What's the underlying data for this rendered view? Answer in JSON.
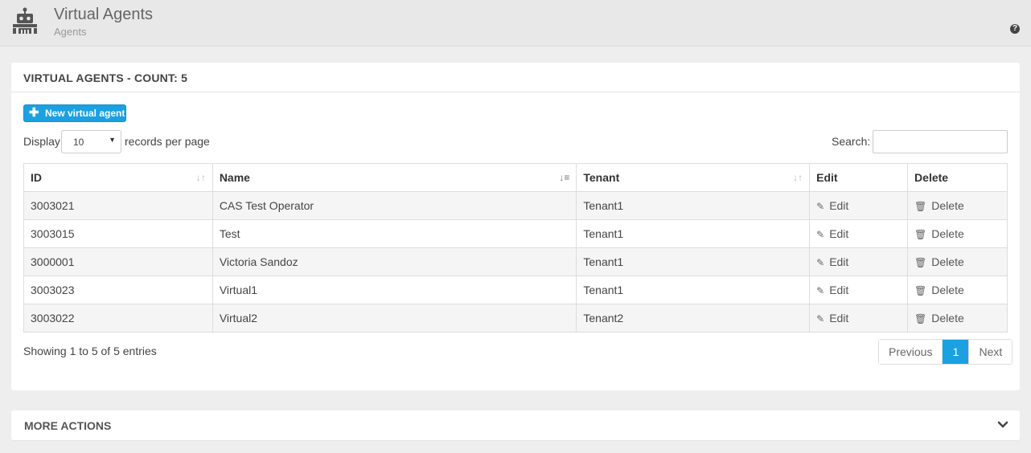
{
  "header": {
    "title": "Virtual Agents",
    "subtitle": "Agents",
    "icon": "robot-icon",
    "help_icon_glyph": "?"
  },
  "panel": {
    "title": "VIRTUAL AGENTS - COUNT: 5",
    "new_button_label": "New virtual agent",
    "display_label": "Display",
    "per_page_value": "10",
    "records_label": "records per page",
    "search_label": "Search:",
    "search_value": ""
  },
  "table": {
    "columns": [
      "ID",
      "Name",
      "Tenant",
      "Edit",
      "Delete"
    ],
    "rows": [
      {
        "id": "3003021",
        "name": "CAS Test Operator",
        "tenant": "Tenant1",
        "edit": "Edit",
        "delete": "Delete"
      },
      {
        "id": "3003015",
        "name": "Test",
        "tenant": "Tenant1",
        "edit": "Edit",
        "delete": "Delete"
      },
      {
        "id": "3000001",
        "name": "Victoria Sandoz",
        "tenant": "Tenant1",
        "edit": "Edit",
        "delete": "Delete"
      },
      {
        "id": "3003023",
        "name": "Virtual1",
        "tenant": "Tenant1",
        "edit": "Edit",
        "delete": "Delete"
      },
      {
        "id": "3003022",
        "name": "Virtual2",
        "tenant": "Tenant2",
        "edit": "Edit",
        "delete": "Delete"
      }
    ]
  },
  "footer": {
    "info": "Showing 1 to 5 of 5 entries",
    "previous": "Previous",
    "current_page": "1",
    "next": "Next"
  },
  "more_actions": {
    "title": "MORE ACTIONS"
  },
  "colors": {
    "accent": "#1ba1e2"
  }
}
